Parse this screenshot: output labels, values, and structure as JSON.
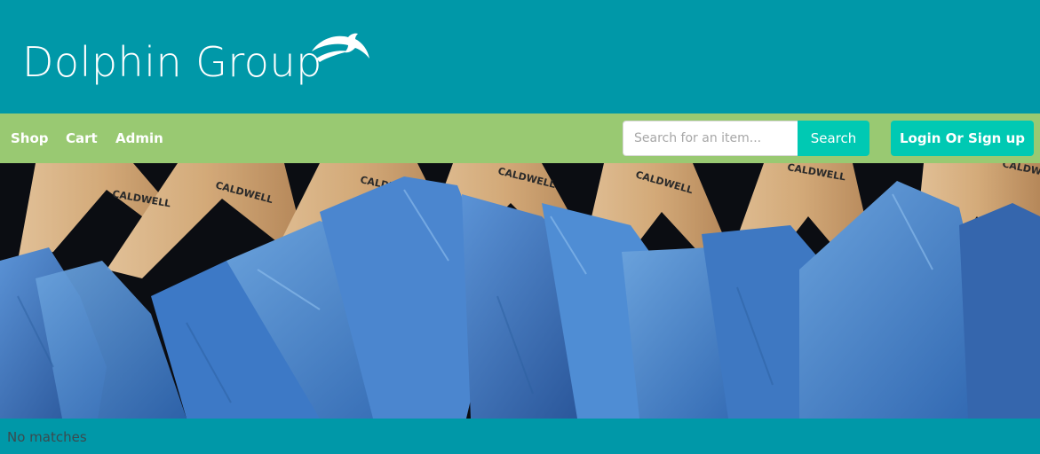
{
  "header": {
    "brand_title": "Dolphin Group",
    "logo_icon": "dolphin-icon",
    "background_color": "#0098a8"
  },
  "nav": {
    "background_color": "#99c972",
    "links": [
      {
        "label": "Shop"
      },
      {
        "label": "Cart"
      },
      {
        "label": "Admin"
      }
    ],
    "search": {
      "placeholder": "Search for an item...",
      "value": "",
      "button_label": "Search"
    },
    "login_label": "Login Or Sign up",
    "accent_color": "#00c9b3"
  },
  "hero": {
    "hanger_brand": "CALDWELL"
  },
  "status": {
    "text": "No matches"
  }
}
